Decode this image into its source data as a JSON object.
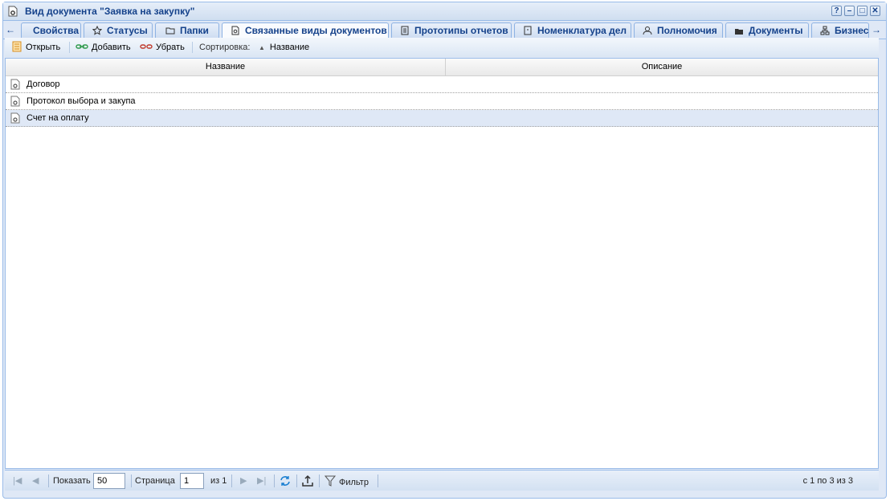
{
  "window": {
    "title": "Вид документа \"Заявка на закупку\"",
    "buttons": [
      "?",
      "–",
      "□",
      "✕"
    ]
  },
  "tabs": [
    {
      "label": "Свойства",
      "icon": "none"
    },
    {
      "label": "Статусы",
      "icon": "star-icon"
    },
    {
      "label": "Папки",
      "icon": "folder-icon"
    },
    {
      "label": "Связанные виды документов",
      "icon": "gear-document-icon",
      "active": true
    },
    {
      "label": "Прототипы отчетов",
      "icon": "report-icon"
    },
    {
      "label": "Номенклатура дел",
      "icon": "nomenclature-icon"
    },
    {
      "label": "Полномочия",
      "icon": "user-key-icon"
    },
    {
      "label": "Документы",
      "icon": "documents-icon"
    },
    {
      "label": "Бизнес-",
      "icon": "hierarchy-icon"
    }
  ],
  "toolbar": {
    "open_label": "Открыть",
    "add_label": "Добавить",
    "remove_label": "Убрать",
    "sort_label": "Сортировка:",
    "sort_field": "Название"
  },
  "grid": {
    "columns": [
      "Название",
      "Описание"
    ],
    "rows": [
      {
        "name": "Договор",
        "description": ""
      },
      {
        "name": "Протокол выбора и закупа",
        "description": ""
      },
      {
        "name": "Счет на оплату",
        "description": "",
        "selected": true
      }
    ]
  },
  "pager": {
    "show_label": "Показать",
    "page_size": "50",
    "page_label": "Страница",
    "page": "1",
    "of_label": "из 1",
    "filter_label": "Фильтр",
    "summary": "с 1 по 3 из 3"
  },
  "colors": {
    "accent": "#15428b",
    "border": "#99bbe8",
    "selected_row": "#dfe8f6"
  }
}
